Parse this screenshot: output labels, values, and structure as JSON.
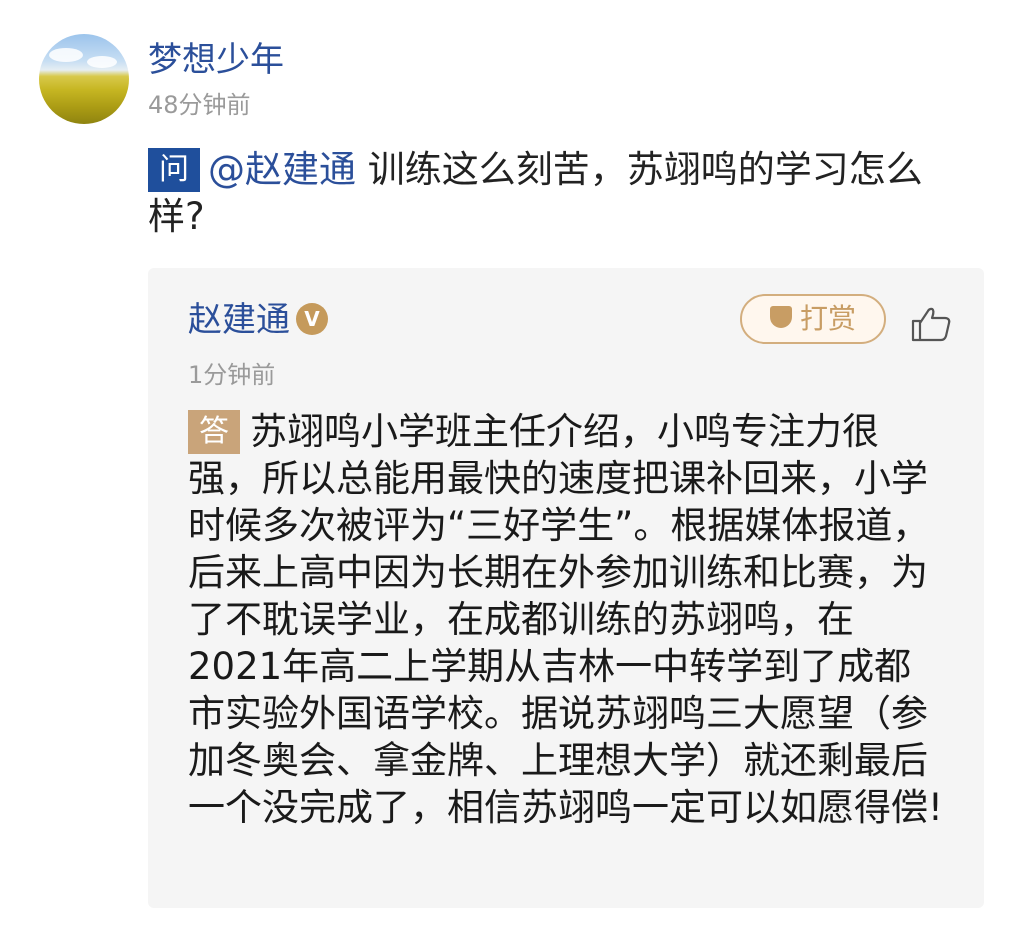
{
  "post": {
    "username": "梦想少年",
    "time": "48分钟前",
    "question_tag": "问",
    "mention": "@赵建通",
    "question_text": " 训练这么刻苦，苏翊鸣的学习怎么样?"
  },
  "answer": {
    "answerer": "赵建通",
    "verified_badge": "V",
    "tip_label": "打赏",
    "time": "1分钟前",
    "answer_tag": "答",
    "answer_text": "苏翊鸣小学班主任介绍，小鸣专注力很强，所以总能用最快的速度把课补回来，小学时候多次被评为“三好学生”。根据媒体报道，后来上高中因为长期在外参加训练和比赛，为了不耽误学业，在成都训练的苏翊鸣，在2021年高二上学期从吉林一中转学到了成都市实验外国语学校。据说苏翊鸣三大愿望（参加冬奥会、拿金牌、上理想大学）就还剩最后一个没完成了，相信苏翊鸣一定可以如愿得偿!"
  },
  "icons": {
    "tip": "gem-icon",
    "like": "thumbs-up-icon"
  },
  "colors": {
    "link_blue": "#2b4f9a",
    "question_tag_bg": "#1f4f9c",
    "answer_tag_bg": "#c9a47a",
    "tip_gold": "#c89d64"
  }
}
